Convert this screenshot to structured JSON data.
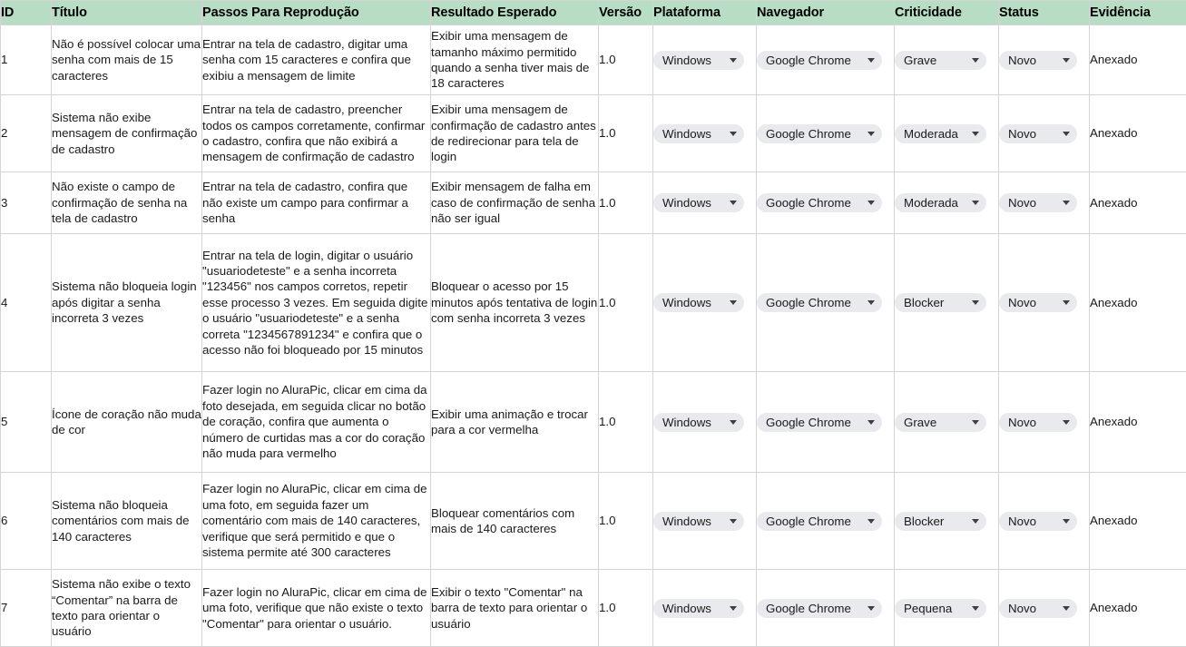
{
  "spreadsheet": {
    "header_background": "#b7dec4",
    "chip_background": "#e8eaed",
    "columns": [
      {
        "key": "id",
        "label": "ID"
      },
      {
        "key": "titulo",
        "label": "Título"
      },
      {
        "key": "passos",
        "label": "Passos Para Reprodução"
      },
      {
        "key": "resultado",
        "label": "Resultado Esperado"
      },
      {
        "key": "versao",
        "label": "Versão"
      },
      {
        "key": "plataforma",
        "label": "Plataforma"
      },
      {
        "key": "navegador",
        "label": "Navegador"
      },
      {
        "key": "criticidade",
        "label": "Criticidade"
      },
      {
        "key": "status",
        "label": "Status"
      },
      {
        "key": "evidencia",
        "label": "Evidência"
      }
    ],
    "rows": [
      {
        "id": "1",
        "titulo": "Não é possível colocar uma senha com mais de 15 caracteres",
        "passos": "Entrar na tela de cadastro, digitar uma senha com 15 caracteres e confira que exibiu a mensagem de limite",
        "resultado": "Exibir uma mensagem de tamanho máximo permitido quando a senha tiver mais de 18 caracteres",
        "versao": "1.0",
        "plataforma": "Windows",
        "navegador": "Google Chrome",
        "criticidade": "Grave",
        "status": "Novo",
        "evidencia": "Anexado"
      },
      {
        "id": "2",
        "titulo": "Sistema não exibe mensagem de confirmação de cadastro",
        "passos": "Entrar na tela de cadastro, preencher todos os campos corretamente, confirmar o cadastro, confira que não exibirá a mensagem de confirmação de cadastro",
        "resultado": "Exibir uma mensagem de confirmação de cadastro antes de redirecionar para tela de login",
        "versao": "1.0",
        "plataforma": "Windows",
        "navegador": "Google Chrome",
        "criticidade": "Moderada",
        "status": "Novo",
        "evidencia": "Anexado"
      },
      {
        "id": "3",
        "titulo": "Não existe o campo de confirmação de senha na tela de cadastro",
        "passos": "Entrar na tela de cadastro, confira que não existe um campo para confirmar a senha",
        "resultado": "Exibir mensagem de falha em caso de confirmação de senha não ser igual",
        "versao": "1.0",
        "plataforma": "Windows",
        "navegador": "Google Chrome",
        "criticidade": "Moderada",
        "status": "Novo",
        "evidencia": "Anexado"
      },
      {
        "id": "4",
        "titulo": "Sistema não bloqueia login após digitar a senha incorreta 3 vezes",
        "passos": "Entrar na tela de login, digitar o usuário \"usuariodeteste\" e a senha incorreta \"123456\" nos campos corretos, repetir esse processo 3 vezes. Em seguida digite o usuário \"usuariodeteste\" e a senha correta \"1234567891234\" e confira que o acesso não foi bloqueado por 15 minutos",
        "resultado": "Bloquear o acesso por 15 minutos após tentativa de login com senha incorreta 3 vezes",
        "versao": "1.0",
        "plataforma": "Windows",
        "navegador": "Google Chrome",
        "criticidade": "Blocker",
        "status": "Novo",
        "evidencia": "Anexado"
      },
      {
        "id": "5",
        "titulo": "Ícone de coração não muda de cor",
        "passos": "Fazer login no AluraPic, clicar em cima da foto desejada, em seguida clicar no botão de coração, confira que aumenta o número de curtidas mas a cor do coração não muda para vermelho",
        "resultado": "Exibir uma animação e trocar para a cor vermelha",
        "versao": "1.0",
        "plataforma": "Windows",
        "navegador": "Google Chrome",
        "criticidade": "Grave",
        "status": "Novo",
        "evidencia": "Anexado"
      },
      {
        "id": "6",
        "titulo": "Sistema não bloqueia comentários com mais de 140 caracteres",
        "passos": "Fazer login no AluraPic, clicar em cima de uma foto, em seguida fazer um comentário com mais de 140 caracteres, verifique que será permitido e que o sistema permite até 300 caracteres",
        "resultado": "Bloquear comentários com mais de 140 caracteres",
        "versao": "1.0",
        "plataforma": "Windows",
        "navegador": "Google Chrome",
        "criticidade": "Blocker",
        "status": "Novo",
        "evidencia": "Anexado"
      },
      {
        "id": "7",
        "titulo": "Sistema não exibe o texto “Comentar” na barra de texto para orientar o usuário",
        "passos": "Fazer login no AluraPic, clicar em cima de uma foto, verifique que não existe o texto \"Comentar\" para orientar o usuário.",
        "resultado": "Exibir o texto \"Comentar\" na barra de texto para orientar o usuário",
        "versao": "1.0",
        "plataforma": "Windows",
        "navegador": "Google Chrome",
        "criticidade": "Pequena",
        "status": "Novo",
        "evidencia": "Anexado"
      }
    ]
  }
}
